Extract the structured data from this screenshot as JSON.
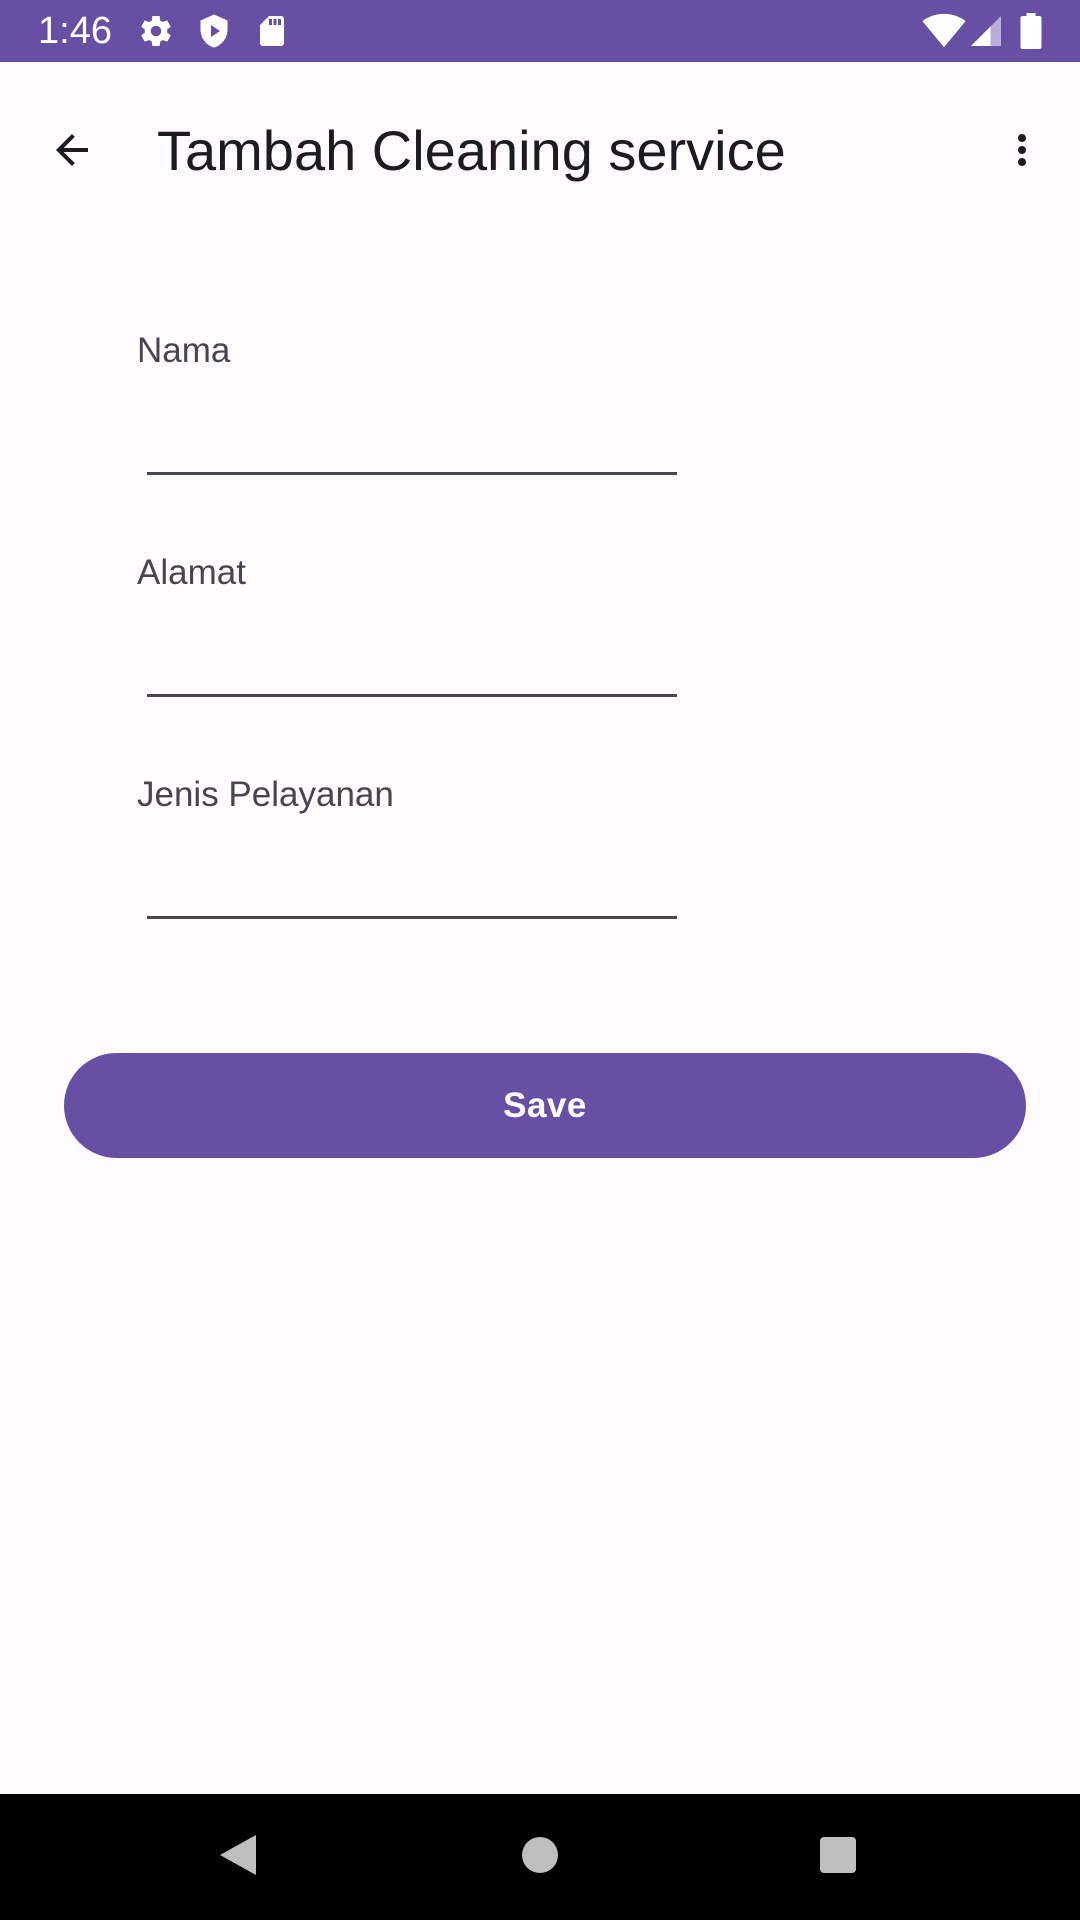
{
  "status_bar": {
    "time": "1:46",
    "icons": [
      "gear-icon",
      "shield-play-icon",
      "sd-card-icon",
      "wifi-icon",
      "signal-icon",
      "battery-icon"
    ],
    "background_color": "#6750a4"
  },
  "app_bar": {
    "title": "Tambah Cleaning service",
    "back_icon": "arrow-back-icon",
    "menu_icon": "more-vert-icon"
  },
  "form": {
    "fields": [
      {
        "label": "Nama",
        "value": "",
        "placeholder": ""
      },
      {
        "label": "Alamat",
        "value": "",
        "placeholder": ""
      },
      {
        "label": "Jenis Pelayanan",
        "value": "",
        "placeholder": ""
      }
    ],
    "save_label": "Save"
  },
  "colors": {
    "accent": "#6750a4",
    "background": "#fffbfe",
    "text": "#1c1b1f",
    "label": "#49454f"
  },
  "nav_bar": {
    "icons": [
      "nav-back-icon",
      "nav-home-icon",
      "nav-recents-icon"
    ]
  }
}
